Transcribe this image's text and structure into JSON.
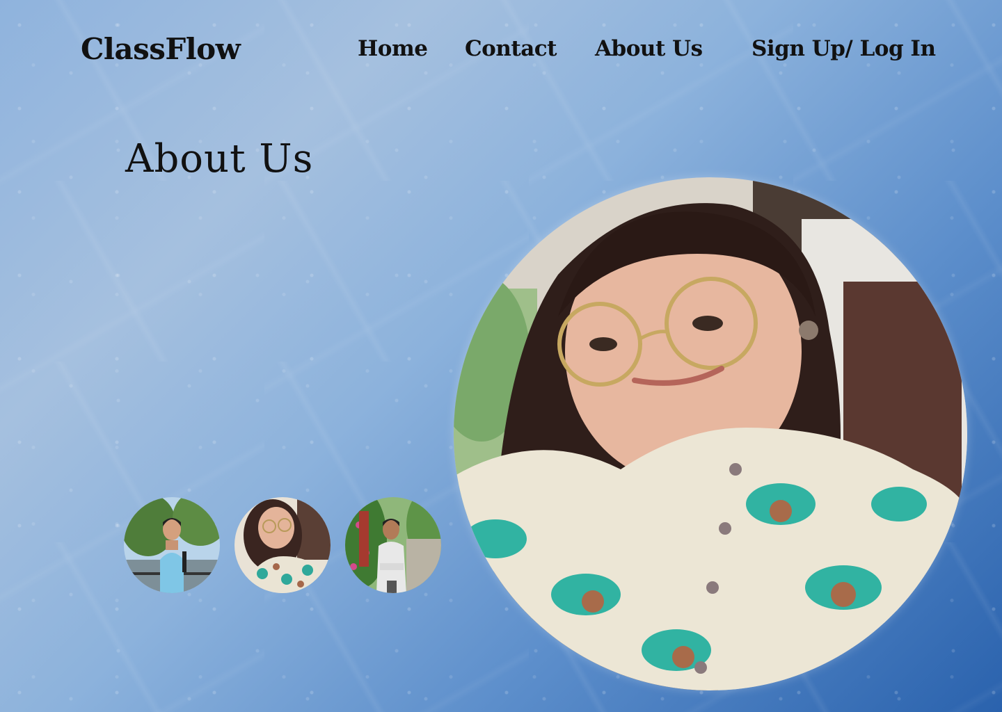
{
  "brand": {
    "name": "ClassFlow"
  },
  "nav": {
    "home": "Home",
    "contact": "Contact",
    "about": "About Us",
    "signup_login": "Sign Up/ Log In"
  },
  "page": {
    "title": "About Us"
  },
  "team": {
    "thumbnails": [
      {
        "icon": "member-photo-1"
      },
      {
        "icon": "member-photo-2"
      },
      {
        "icon": "member-photo-3"
      }
    ],
    "featured": {
      "icon": "member-photo-featured"
    }
  },
  "colors": {
    "text": "#111111",
    "background_light": "#a5c0df",
    "background_dark": "#2a62ad"
  }
}
